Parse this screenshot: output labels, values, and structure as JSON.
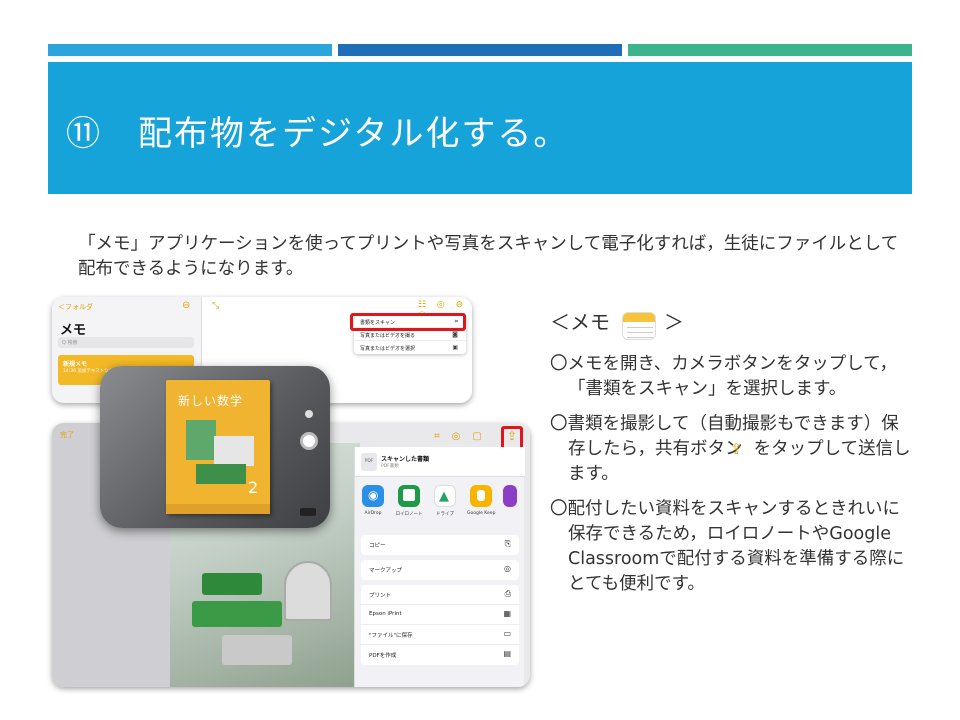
{
  "slide": {
    "title": "⑪　配布物をデジタル化する。",
    "intro": "「メモ」アプリケーションを使ってプリントや写真をスキャンして電子化すれば，生徒にファイルとして配布できるようになります。"
  },
  "colors": {
    "stripe1": "#2ca4dc",
    "stripe2": "#1e6fb8",
    "stripe3": "#3db38e",
    "title_band": "#16a3d9",
    "highlight": "#e0161a",
    "notes_accent": "#e3a400"
  },
  "screen1": {
    "back_label": "＜フォルダ",
    "heading": "メモ",
    "search_placeholder": "Q 検索",
    "note_title": "新規メモ",
    "note_subtitle": "14:36 追加テキストなし",
    "menu": [
      {
        "label": "書類をスキャン",
        "icon": "scan-icon"
      },
      {
        "label": "写真またはビデオを撮る",
        "icon": "camera-icon"
      },
      {
        "label": "写真またはビデオを選択",
        "icon": "photo-icon"
      }
    ]
  },
  "screen2": {
    "done_label": "完了",
    "page_text": "数学",
    "share_sheet": {
      "badge": "PDF",
      "title": "スキャンした書類",
      "subtitle": "PDF書類",
      "apps": [
        {
          "label": "AirDrop",
          "color": "#2b8fe6"
        },
        {
          "label": "ロイロノート",
          "color": "#1f9a48"
        },
        {
          "label": "ドライブ",
          "color": "#ffffff"
        },
        {
          "label": "Google Keep",
          "color": "#f7b500"
        }
      ],
      "actions": [
        {
          "label": "コピー",
          "icon": "copy-icon"
        },
        {
          "label": "マークアップ",
          "icon": "markup-icon"
        },
        {
          "label": "プリント",
          "icon": "print-icon"
        },
        {
          "label": "Epson iPrint",
          "icon": "epson-icon"
        },
        {
          "label": "\"ファイル\"に保存",
          "icon": "folder-icon"
        },
        {
          "label": "PDFを作成",
          "icon": "pdf-icon"
        }
      ]
    }
  },
  "book": {
    "title": "新しい数学",
    "grade": "2"
  },
  "right": {
    "heading_open": "＜メモ",
    "heading_close": "＞",
    "bullet1": "〇メモを開き、カメラボタンをタップして，「書類をスキャン」を選択します。",
    "bullet2_pre": "〇書類を撮影して（自動撮影もできます）保存したら，共有ボタン",
    "bullet2_post": "をタップして送信します。",
    "bullet3": "〇配付したい資料をスキャンするときれいに保存できるため，ロイロノートやGoogle Classroomで配付する資料を準備する際にとても便利です。"
  }
}
